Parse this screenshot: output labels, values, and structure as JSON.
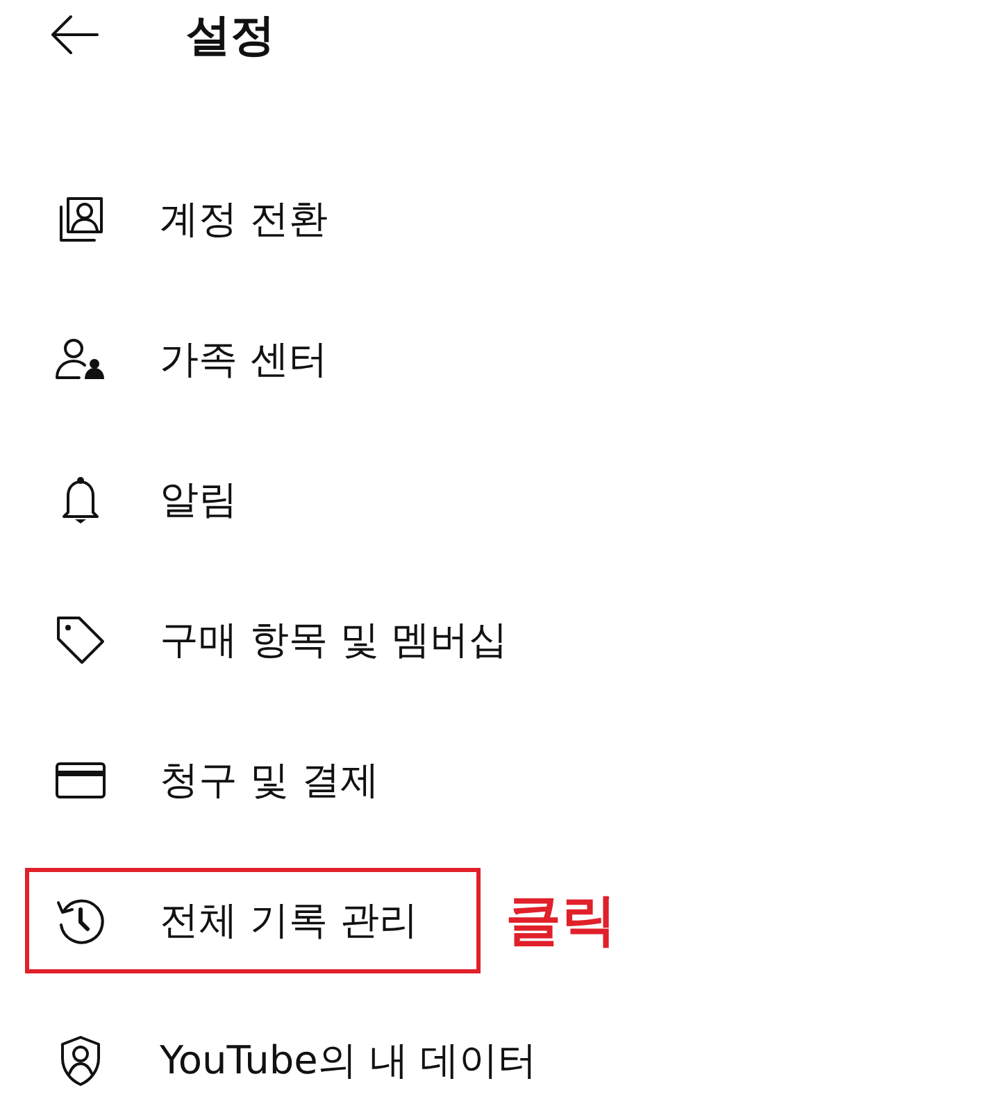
{
  "header": {
    "title": "설정"
  },
  "items": [
    {
      "label": "계정 전환",
      "highlighted": false
    },
    {
      "label": "가족 센터",
      "highlighted": false
    },
    {
      "label": "알림",
      "highlighted": false
    },
    {
      "label": "구매 항목 및 멤버십",
      "highlighted": false
    },
    {
      "label": "청구 및 결제",
      "highlighted": false
    },
    {
      "label": "전체 기록 관리",
      "highlighted": true,
      "annotation": "클릭"
    },
    {
      "label": "YouTube의 내 데이터",
      "highlighted": false
    }
  ]
}
